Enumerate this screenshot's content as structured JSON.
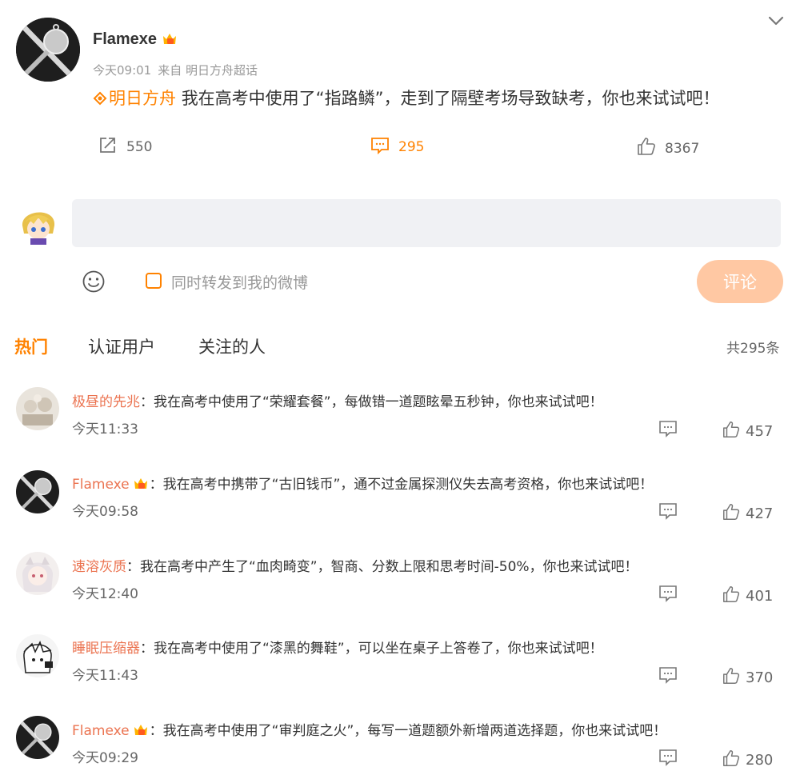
{
  "post": {
    "author": "Flamexe",
    "time": "今天09:01",
    "source": "来自 明日方舟超话",
    "topic": "明日方舟",
    "text": "我在高考中使用了“指路鳞”，走到了隔壁考场导致缺考，你也来试试吧！",
    "reposts": "550",
    "comments": "295",
    "likes": "8367"
  },
  "composer": {
    "placeholder": "",
    "repost_label": "同时转发到我的微博",
    "submit_label": "评论"
  },
  "tabs": {
    "hot": "热门",
    "verified": "认证用户",
    "following": "关注的人",
    "total": "共295条"
  },
  "comments": [
    {
      "user": "极昼的先兆",
      "sep": "：",
      "text": "我在高考中使用了“荣耀套餐”，每做错一道题眩晕五秒钟，你也来试试吧！",
      "time": "今天11:33",
      "likes": "457"
    },
    {
      "user": "Flamexe",
      "sep": "：",
      "text": "我在高考中携带了“古旧钱币”，通不过金属探测仪失去高考资格，你也来试试吧！",
      "time": "今天09:58",
      "likes": "427"
    },
    {
      "user": "速溶灰质",
      "sep": "：",
      "text": "我在高考中产生了“血肉畸变”，智商、分数上限和思考时间-50%，你也来试试吧！",
      "time": "今天12:40",
      "likes": "401"
    },
    {
      "user": "睡眠压缩器",
      "sep": "：",
      "text": "我在高考中使用了“漆黑的舞鞋”，可以坐在桌子上答卷了，你也来试试吧！",
      "time": "今天11:43",
      "likes": "370"
    },
    {
      "user": "Flamexe",
      "sep": "：",
      "text": "我在高考中使用了“审判庭之火”，每写一道题额外新增两道选择题，你也来试试吧！",
      "time": "今天09:29",
      "likes": "280"
    }
  ],
  "colors": {
    "accent": "#ff8200",
    "username": "#eb7350",
    "submit_disabled": "#ffc8a3"
  },
  "icons": {
    "chevron": "chevron-down-icon",
    "repost": "repost-icon",
    "comment": "comment-icon",
    "like": "thumbs-up-icon",
    "emoji": "emoji-icon",
    "vip": "vip-crown-icon",
    "topic": "supertopic-icon"
  }
}
